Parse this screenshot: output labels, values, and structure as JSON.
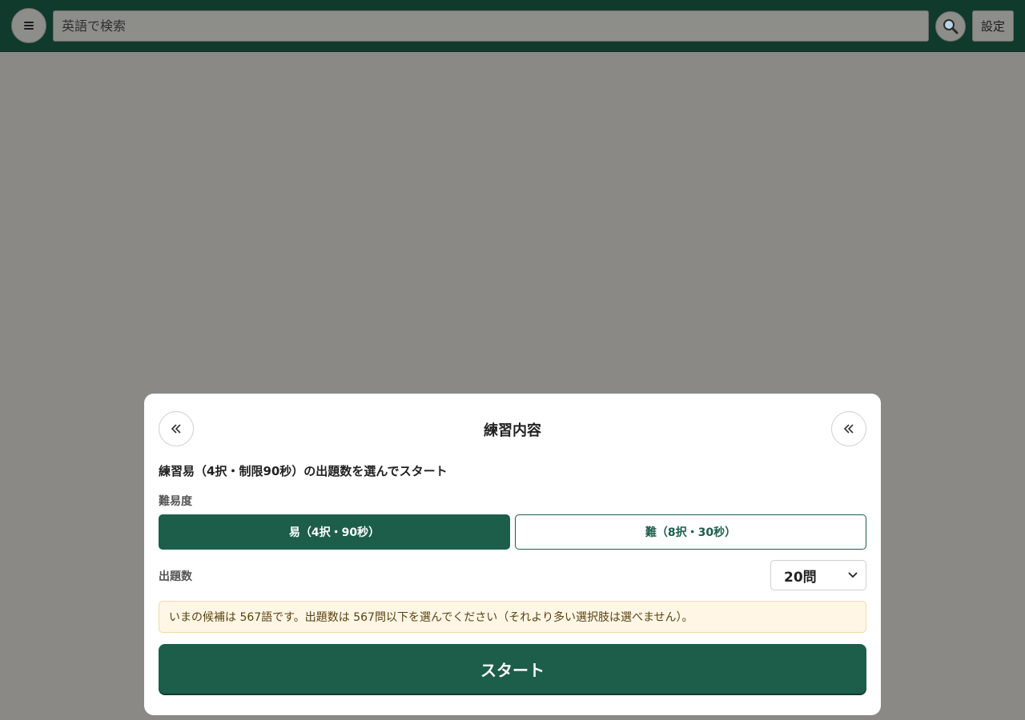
{
  "header": {
    "search_placeholder": "英語で検索",
    "settings_label": "設定",
    "icons": {
      "menu": "menu-icon",
      "search": "search-icon"
    }
  },
  "modal": {
    "title": "練習内容",
    "subtitle": "練習易（4択・制限90秒）の出題数を選んでスタート",
    "difficulty_label": "難易度",
    "difficulty_options": [
      {
        "label": "易（4択・90秒）",
        "selected": true
      },
      {
        "label": "難（8択・30秒）",
        "selected": false
      }
    ],
    "count_label": "出題数",
    "count_selected": "20問",
    "notice": "いまの候補は 567語です。出題数は 567問以下を選んでください（それより多い選択肢は選べません）。",
    "start_label": "スタート",
    "icons": {
      "back_left": "double-chevron-left-icon",
      "back_right": "double-chevron-left-icon"
    }
  },
  "colors": {
    "header_bg": "#0f3a2c",
    "accent": "#1c5e4a",
    "overlay": "#8a8985",
    "notice_bg": "#fff6e6"
  }
}
